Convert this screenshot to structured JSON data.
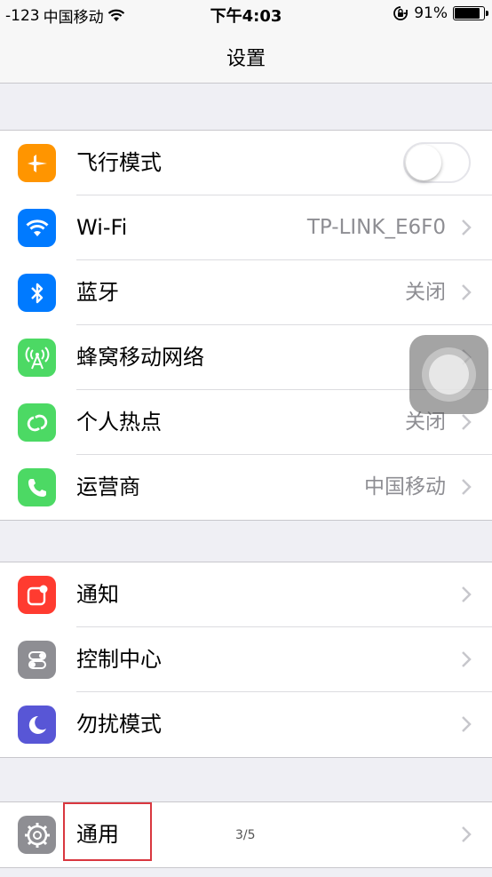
{
  "status_bar": {
    "signal": "-123",
    "carrier": "中国移动",
    "wifi_icon": "wifi-icon",
    "time": "下午4:03",
    "lock_icon": "orientation-lock-icon",
    "battery_percent": "91%",
    "battery_level": 0.91
  },
  "nav": {
    "title": "设置"
  },
  "groups": [
    {
      "rows": [
        {
          "label": "飞行模式",
          "icon": "airplane-icon",
          "color": "#ff9500",
          "toggle": false
        },
        {
          "label": "Wi-Fi",
          "icon": "wifi-icon",
          "color": "#007aff",
          "value": "TP-LINK_E6F0"
        },
        {
          "label": "蓝牙",
          "icon": "bluetooth-icon",
          "color": "#007aff",
          "value": "关闭"
        },
        {
          "label": "蜂窝移动网络",
          "icon": "cellular-antenna-icon",
          "color": "#4cd964"
        },
        {
          "label": "个人热点",
          "icon": "hotspot-icon",
          "color": "#4cd964",
          "value": "关闭"
        },
        {
          "label": "运营商",
          "icon": "phone-icon",
          "color": "#4cd964",
          "value": "中国移动"
        }
      ]
    },
    {
      "rows": [
        {
          "label": "通知",
          "icon": "notifications-icon",
          "color": "#ff3b30"
        },
        {
          "label": "控制中心",
          "icon": "control-center-icon",
          "color": "#8e8e93"
        },
        {
          "label": "勿扰模式",
          "icon": "moon-icon",
          "color": "#5856d6"
        }
      ]
    },
    {
      "rows": [
        {
          "label": "通用",
          "icon": "gear-icon",
          "color": "#8e8e93"
        }
      ]
    }
  ],
  "page_indicator": "3/5"
}
